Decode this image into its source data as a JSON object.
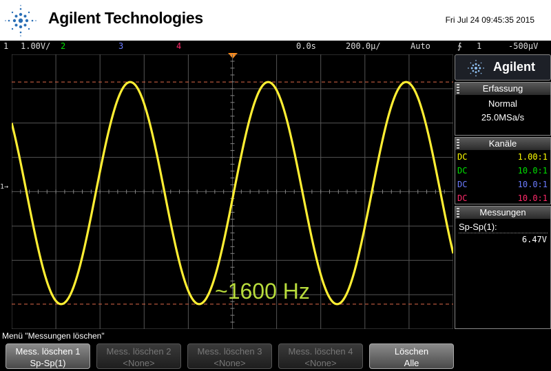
{
  "header": {
    "brand": "Agilent Technologies",
    "datetime": "Fri Jul 24 09:45:35 2015"
  },
  "status": {
    "ch1_num": "1",
    "ch1_scale": "1.00V/",
    "ch2_num": "2",
    "ch3_num": "3",
    "ch4_num": "4",
    "time_delay": "0.0s",
    "time_scale": "200.0µ/",
    "trigger_mode": "Auto",
    "trigger_symbol": "∱",
    "trigger_source": "1",
    "trigger_level": "-500µV"
  },
  "screen": {
    "annotation": "~1600 Hz",
    "ground_marker": "1→"
  },
  "side": {
    "logo": "Agilent",
    "acq_title": "Erfassung",
    "acq_mode": "Normal",
    "acq_rate": "25.0MSa/s",
    "channels_title": "Kanäle",
    "channels": [
      {
        "coupling": "DC",
        "probe": "1.00:1",
        "color": "#ffff00"
      },
      {
        "coupling": "DC",
        "probe": "10.0:1",
        "color": "#00e000"
      },
      {
        "coupling": "DC",
        "probe": "10.0:1",
        "color": "#6b7bff"
      },
      {
        "coupling": "DC",
        "probe": "10.0:1",
        "color": "#ff2a6a"
      }
    ],
    "meas_title": "Messungen",
    "meas_label": "Sp-Sp(1):",
    "meas_value": "6.47V"
  },
  "menu": {
    "title": "Menü \"Messungen löschen\"",
    "softkeys": [
      {
        "line1": "Mess. löschen 1",
        "line2": "Sp-Sp(1)",
        "active": true
      },
      {
        "line1": "Mess. löschen 2",
        "line2": "<None>",
        "active": false
      },
      {
        "line1": "Mess. löschen 3",
        "line2": "<None>",
        "active": false
      },
      {
        "line1": "Mess. löschen 4",
        "line2": "<None>",
        "active": false
      },
      {
        "line1": "Löschen",
        "line2": "Alle",
        "active": true
      }
    ]
  },
  "colors": {
    "trace": "#ffee33",
    "cursor": "#e06a4a",
    "grid": "#555555",
    "annotation": "#b8dc3c",
    "ch2": "#00e000",
    "ch3": "#6b7bff",
    "ch4": "#ff2a6a"
  },
  "waveform": {
    "frequency_hz": 1600,
    "peak_to_peak_v": 6.47,
    "time_per_div_s": 0.0002,
    "volts_per_div": 1.0
  }
}
